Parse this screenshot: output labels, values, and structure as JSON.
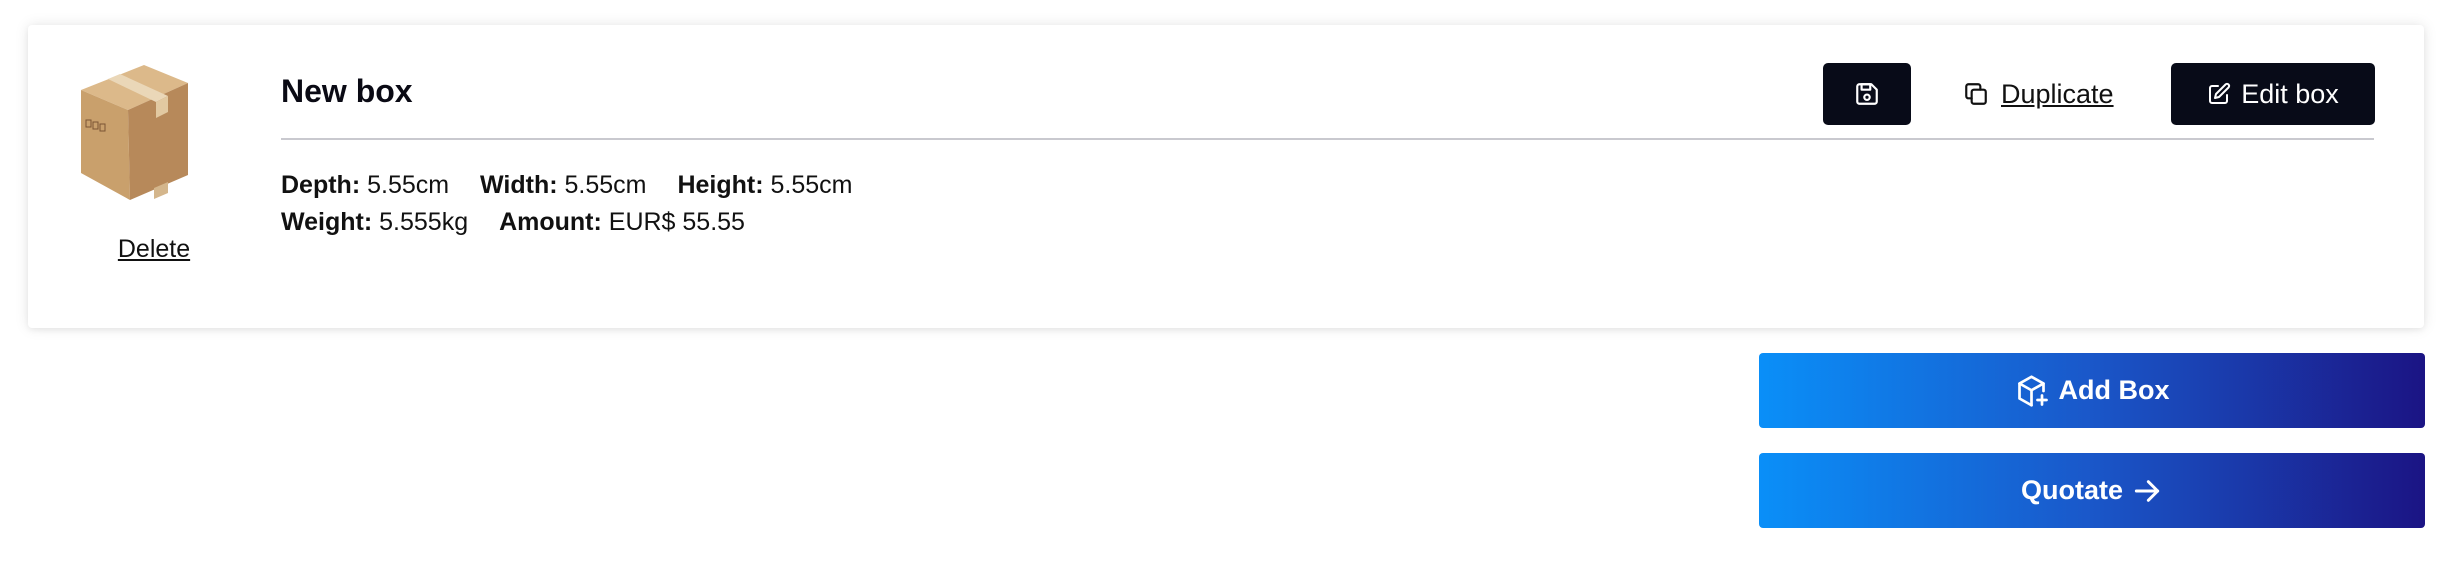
{
  "box_card": {
    "title": "New box",
    "delete_label": "Delete",
    "duplicate_label": "Duplicate",
    "edit_label": "Edit box",
    "specs": {
      "depth_label": "Depth:",
      "depth_value": "5.55cm",
      "width_label": "Width:",
      "width_value": "5.55cm",
      "height_label": "Height:",
      "height_value": "5.55cm",
      "weight_label": "Weight:",
      "weight_value": "5.555kg",
      "amount_label": "Amount:",
      "amount_value": "EUR$ 55.55"
    },
    "icons": {
      "save": "save-icon",
      "duplicate": "copy-icon",
      "edit": "edit-icon",
      "box_image": "cardboard-box-image"
    }
  },
  "actions": {
    "add_box_label": "Add Box",
    "quotate_label": "Quotate",
    "add_box_icon": "box-plus-icon",
    "quotate_icon": "arrow-right-icon"
  },
  "colors": {
    "dark_button": "#080b18",
    "gradient_start": "#0a8ff8",
    "gradient_end": "#1b1484"
  }
}
